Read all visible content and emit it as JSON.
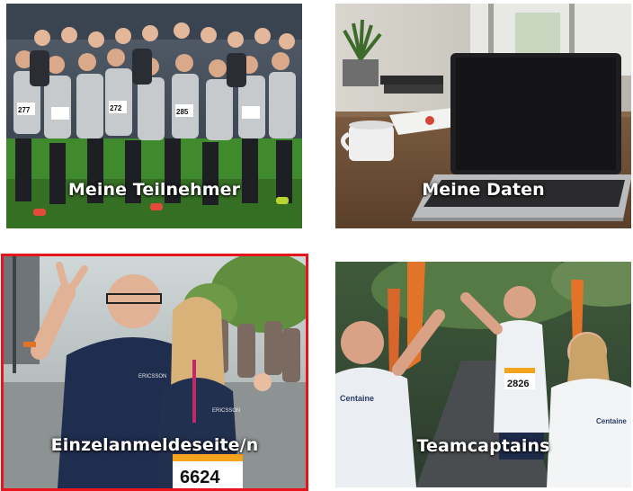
{
  "tiles": [
    {
      "label": "Meine Teilnehmer",
      "selected": false
    },
    {
      "label": "Meine Daten",
      "selected": false
    },
    {
      "label": "Einzelanmeldeseite/n",
      "selected": true
    },
    {
      "label": "Teamcaptains",
      "selected": false
    }
  ],
  "bib_numbers": {
    "einzel_runner": "6624",
    "teamcaptain_runner": "2826",
    "participant_1": "277",
    "participant_2": "272",
    "participant_3": "285"
  },
  "shirt_text": {
    "ericsson": "ERICSSON",
    "team_brand": "Centaine"
  },
  "colors": {
    "label_text": "#ffffff",
    "selected_border": "#e8141b",
    "grass": "#3f8a2c",
    "laptop": "#1e1e20",
    "navy_shirt": "#1f2d4f",
    "orange_flag": "#e2742a"
  },
  "icons": {
    "participants_tile": "group-photo-runners",
    "data_tile": "laptop-on-desk",
    "single_tile": "runners-selfie",
    "captains_tile": "high-five-runners"
  }
}
